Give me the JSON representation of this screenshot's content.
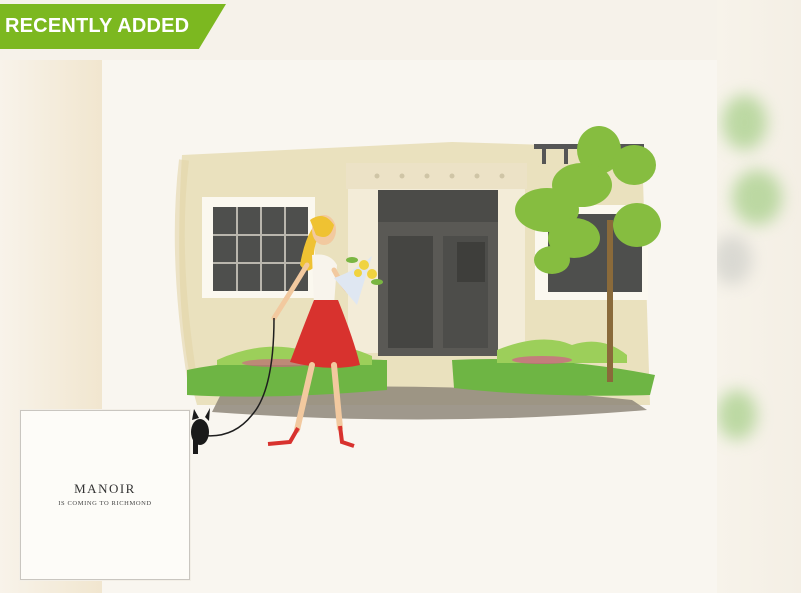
{
  "badge": {
    "label": "RECENTLY ADDED",
    "color": "#7cb820"
  },
  "thumbnail": {
    "logo_title": "MANOIR",
    "logo_subtitle": "IS COMING TO RICHMOND"
  },
  "illustration": {
    "subject": "woman-walking-dog-in-front-of-house",
    "colors": {
      "wall": "#e9dfba",
      "door": "#5a5955",
      "dress": "#d8322e",
      "hair": "#efc232",
      "grass": "#6eb544",
      "tree": "#86bd40"
    }
  }
}
